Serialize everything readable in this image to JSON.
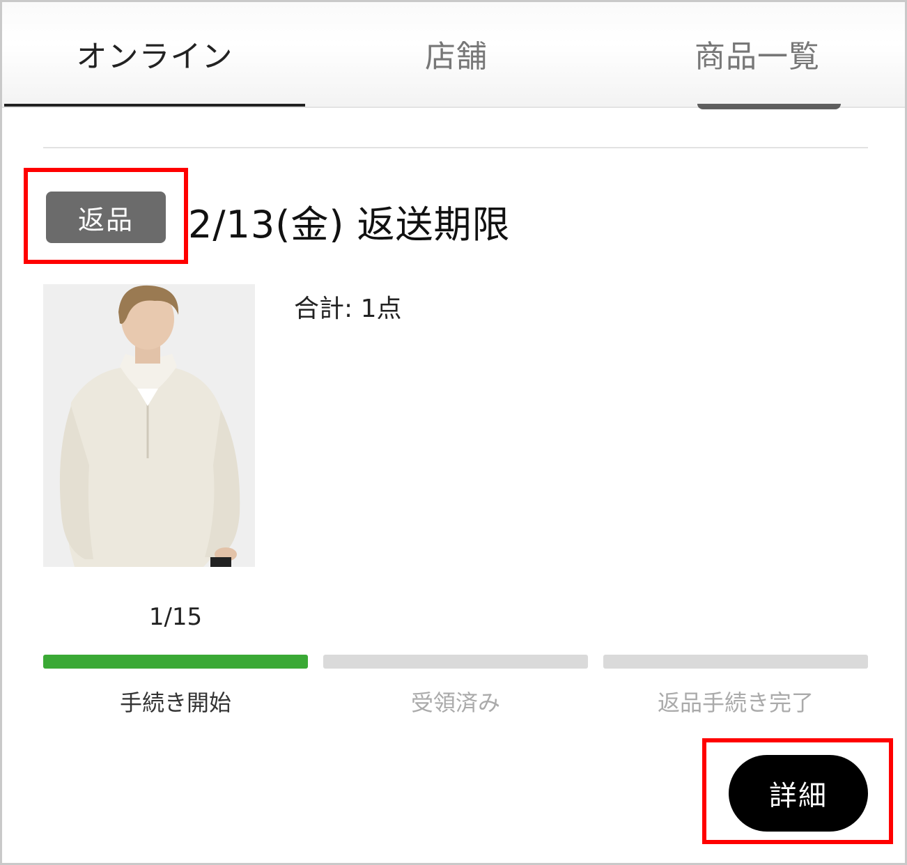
{
  "tabs": [
    {
      "label": "オンライン",
      "active": true
    },
    {
      "label": "店舗",
      "active": false
    },
    {
      "label": "商品一覧",
      "active": false
    }
  ],
  "order": {
    "badge": "返品",
    "deadline": "2/13(金) 返送期限",
    "total": "合計: 1点",
    "image_counter": "1/15",
    "image_alt": "model wearing cream half-zip sweater"
  },
  "progress": {
    "steps": [
      {
        "label": "手続き開始",
        "completed": true
      },
      {
        "label": "受領済み",
        "completed": false
      },
      {
        "label": "返品手続き完了",
        "completed": false
      }
    ],
    "active_color": "#3aa935",
    "inactive_color": "#dadada"
  },
  "actions": {
    "details_label": "詳細"
  },
  "annotations": {
    "highlight_color": "#ff0000"
  }
}
